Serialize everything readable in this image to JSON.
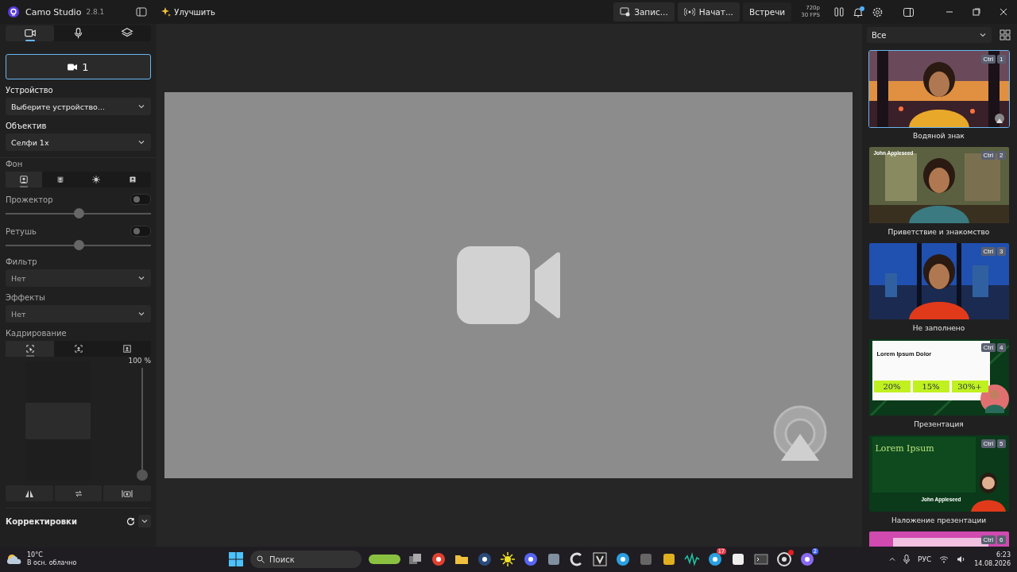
{
  "titlebar": {
    "app_name": "Camo Studio",
    "version": "2.8.1",
    "upgrade": "Улучшить",
    "buttons": [
      "Запис...",
      "Начат...",
      "Встречи"
    ],
    "resolution": "720p",
    "fps": "30 FPS",
    "notification_dot": true
  },
  "left_panel": {
    "tabs": [
      {
        "kind": "camera",
        "selected": true
      },
      {
        "kind": "mic",
        "selected": false
      },
      {
        "kind": "layers",
        "selected": false
      }
    ],
    "camera_button": "1",
    "device": {
      "label": "Устройство",
      "value": "Выберите устройство..."
    },
    "lens": {
      "label": "Объектив",
      "value": "Селфи 1x"
    },
    "background": {
      "label": "Фон",
      "modes": [
        {
          "kind": "portrait",
          "selected": true
        },
        {
          "kind": "blur",
          "selected": false
        },
        {
          "kind": "effect",
          "selected": false
        },
        {
          "kind": "replace",
          "selected": false
        }
      ]
    },
    "spotlight": {
      "label": "Прожектор",
      "on": false,
      "level": 0.5
    },
    "retouch": {
      "label": "Ретушь",
      "on": false,
      "level": 0.5
    },
    "filter": {
      "label": "Фильтр",
      "value": "Нет"
    },
    "effects": {
      "label": "Эффекты",
      "value": "Нет"
    },
    "framing": {
      "label": "Кадрирование",
      "modes": [
        {
          "kind": "auto",
          "selected": true
        },
        {
          "kind": "person",
          "selected": false
        },
        {
          "kind": "center",
          "selected": false
        }
      ],
      "zoom": "100 %",
      "level": 0
    },
    "adjustments": {
      "label": "Корректировки"
    }
  },
  "scenes": {
    "filter": "Все",
    "items": [
      {
        "caption": "Водяной знак",
        "shortcut": "Ctrl",
        "number": "1",
        "selected": true,
        "kind": "sunset"
      },
      {
        "caption": "Приветствие и знакомство",
        "shortcut": "Ctrl",
        "number": "2",
        "selected": false,
        "kind": "room",
        "overlay": "John Appleseed"
      },
      {
        "caption": "Не заполнено",
        "shortcut": "Ctrl",
        "number": "3",
        "selected": false,
        "kind": "city"
      },
      {
        "caption": "Презентация",
        "shortcut": "Ctrl",
        "number": "4",
        "selected": false,
        "kind": "slide",
        "slide_title": "Lorem Ipsum Dolor",
        "stats": [
          "20%",
          "15%",
          "30%+"
        ]
      },
      {
        "caption": "Наложение презентации",
        "shortcut": "Ctrl",
        "number": "5",
        "selected": false,
        "kind": "green-slide",
        "slide_title": "Lorem Ipsum",
        "overlay": "John Appleseed"
      },
      {
        "shortcut": "Ctrl",
        "number": "6",
        "selected": false,
        "kind": "pink"
      }
    ]
  },
  "taskbar": {
    "weather": {
      "temp": "10°C",
      "desc": "В осн. облачно"
    },
    "search": {
      "placeholder": "Поиск"
    },
    "apps": [
      {
        "kind": "widget"
      },
      {
        "kind": "squares"
      },
      {
        "kind": "browser"
      },
      {
        "kind": "folder"
      },
      {
        "kind": "steam"
      },
      {
        "kind": "sun"
      },
      {
        "kind": "chat"
      },
      {
        "kind": "tool"
      },
      {
        "kind": "c"
      },
      {
        "kind": "v"
      },
      {
        "kind": "plane"
      },
      {
        "kind": "cube"
      },
      {
        "kind": "horn"
      },
      {
        "kind": "wave"
      },
      {
        "kind": "plane",
        "badge": "17"
      },
      {
        "kind": "cut"
      },
      {
        "kind": "terminal"
      },
      {
        "kind": "record",
        "dot": true
      },
      {
        "kind": "ring",
        "badge": "2"
      }
    ],
    "tray": {
      "lang": "РУС",
      "time": "6:23",
      "date": "14.08.2026"
    }
  }
}
